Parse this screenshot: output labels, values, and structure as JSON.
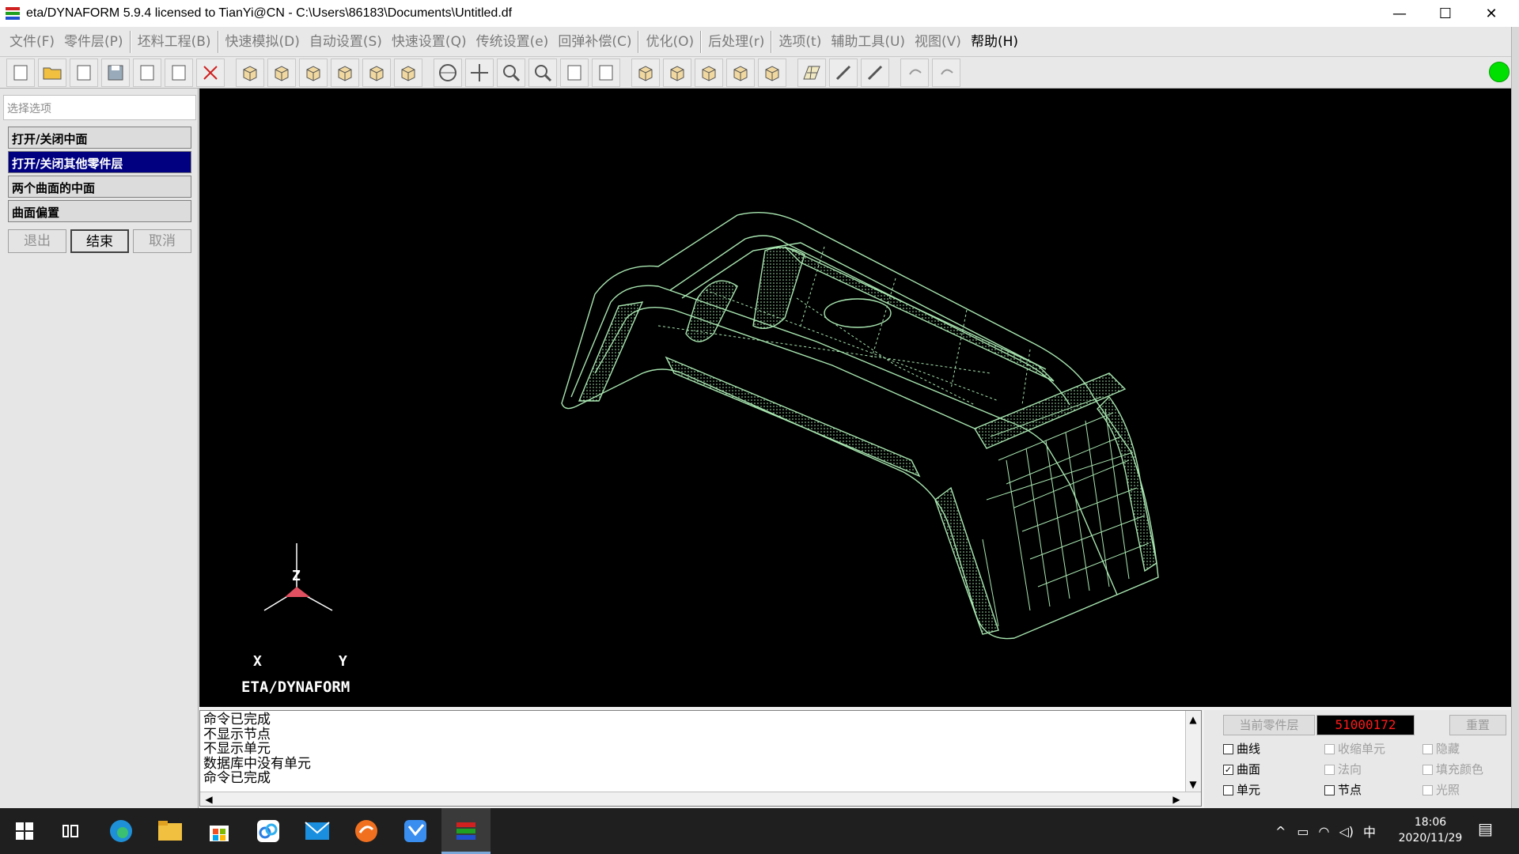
{
  "window": {
    "title": "eta/DYNAFORM 5.9.4 licensed to TianYi@CN - C:\\Users\\86183\\Documents\\Untitled.df",
    "min_glyph": "—",
    "max_glyph": "☐",
    "close_glyph": "✕"
  },
  "menu": {
    "items": [
      {
        "label": "文件(F)",
        "active": false
      },
      {
        "label": "零件层(P)",
        "active": false
      },
      {
        "label": "坯料工程(B)",
        "active": false
      },
      {
        "label": "快速模拟(D)",
        "active": false
      },
      {
        "label": "自动设置(S)",
        "active": false
      },
      {
        "label": "快速设置(Q)",
        "active": false
      },
      {
        "label": "传统设置(e)",
        "active": false
      },
      {
        "label": "回弹补偿(C)",
        "active": false
      },
      {
        "label": "优化(O)",
        "active": false
      },
      {
        "label": "后处理(r)",
        "active": false
      },
      {
        "label": "选项(t)",
        "active": false
      },
      {
        "label": "辅助工具(U)",
        "active": false
      },
      {
        "label": "视图(V)",
        "active": false
      },
      {
        "label": "帮助(H)",
        "active": true
      }
    ]
  },
  "toolbar": {
    "buttons": [
      "new-file-icon",
      "open-folder-icon",
      "copy-icon",
      "save-icon",
      "print-icon",
      "plot-icon",
      "cut-icon",
      "cube-front-icon",
      "cube-back-icon",
      "cube-top-icon",
      "cube-left-icon",
      "cube-right-icon",
      "cube-iso-icon",
      "rotate-icon",
      "pan-icon",
      "zoom-icon",
      "zoom-window-icon",
      "fit-icon",
      "frame-icon",
      "view-iso-icon",
      "view-top-icon",
      "view-front-icon",
      "view-side-icon",
      "view-3d-icon",
      "mesh-icon",
      "brush-icon",
      "pencil-icon",
      "undo-icon",
      "redo-icon"
    ]
  },
  "left_panel": {
    "header": "选择选项",
    "options": [
      "打开/关闭中面",
      "打开/关闭其他零件层",
      "两个曲面的中面",
      "曲面偏置"
    ],
    "selected_index": 1,
    "buttons": {
      "exit": "退出",
      "finish": "结束",
      "cancel": "取消"
    }
  },
  "viewport": {
    "axis_z": "Z",
    "axis_x": "X",
    "axis_y": "Y",
    "brand": "ETA/DYNAFORM",
    "mesh_color": "#a8e6b0"
  },
  "console": {
    "lines": [
      "命令已完成",
      "不显示节点",
      "不显示单元",
      "数据库中没有单元",
      "命令已完成"
    ]
  },
  "control_panel": {
    "current_part_label": "当前零件层",
    "current_part_value": "51000172",
    "reset": "重置",
    "checkboxes": [
      {
        "label": "曲线",
        "checked": false,
        "enabled": true
      },
      {
        "label": "收缩单元",
        "checked": false,
        "enabled": false
      },
      {
        "label": "隐藏",
        "checked": false,
        "enabled": false
      },
      {
        "label": "曲面",
        "checked": true,
        "enabled": true
      },
      {
        "label": "法向",
        "checked": false,
        "enabled": false
      },
      {
        "label": "填充颜色",
        "checked": false,
        "enabled": false
      },
      {
        "label": "单元",
        "checked": false,
        "enabled": true
      },
      {
        "label": "节点",
        "checked": false,
        "enabled": true
      },
      {
        "label": "光照",
        "checked": false,
        "enabled": false
      }
    ]
  },
  "taskbar": {
    "ime": "中",
    "time": "18:06",
    "date": "2020/11/29"
  }
}
